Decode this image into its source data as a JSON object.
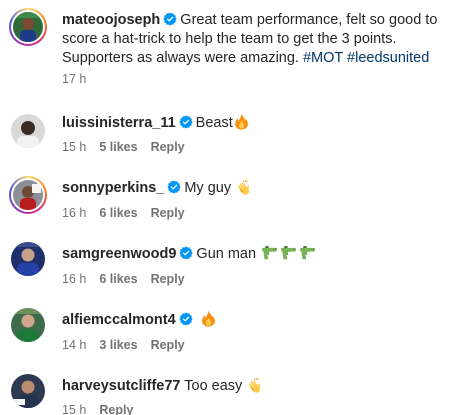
{
  "post": {
    "username": "mateoojoseph",
    "caption": "Great team performance, felt so good to score a hat-trick to help the team to get the 3 points. Supporters as always were amazing.",
    "hashtags": [
      "#MOT",
      "#leedsunited"
    ],
    "time": "17 h"
  },
  "comments": [
    {
      "username": "luissinisterra_11",
      "text": "Beast",
      "emoji": "fire-emoji",
      "time": "15 h",
      "likes": "5 likes",
      "reply": "Reply"
    },
    {
      "username": "sonnyperkins_",
      "text": "My guy",
      "emoji": "clap-emoji",
      "time": "16 h",
      "likes": "6 likes",
      "reply": "Reply"
    },
    {
      "username": "samgreenwood9",
      "text": "Gun man",
      "emoji": "water-pistol-emoji",
      "time": "16 h",
      "likes": "6 likes",
      "reply": "Reply"
    },
    {
      "username": "alfiemccalmont4",
      "text": "",
      "emoji": "fire-emoji",
      "time": "14 h",
      "likes": "3 likes",
      "reply": "Reply"
    },
    {
      "username": "harveysutcliffe77",
      "text": "Too easy",
      "emoji": "clap-emoji",
      "time": "15 h",
      "likes": "",
      "reply": "Reply"
    }
  ],
  "colors": {
    "verified": "#0095f6",
    "hashtag": "#00376b",
    "meta": "#737373",
    "text": "#262626"
  }
}
